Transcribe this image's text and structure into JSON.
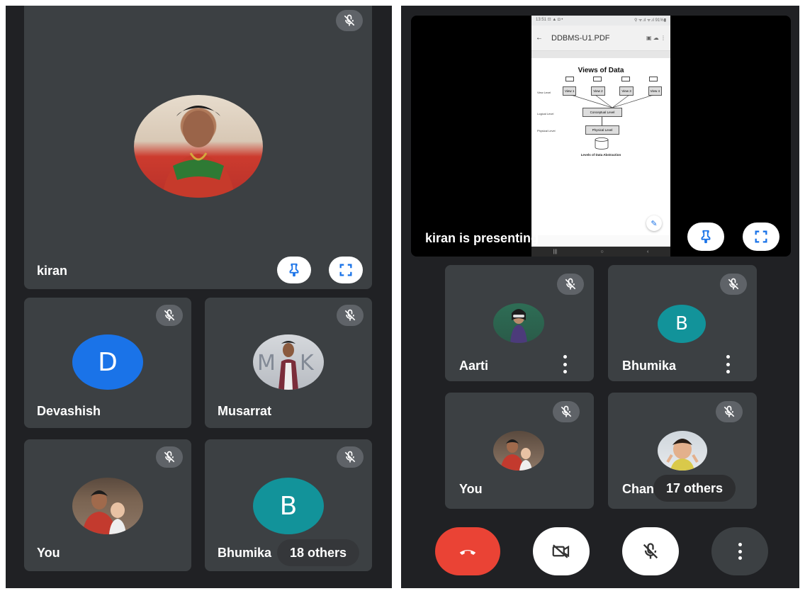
{
  "left_screen": {
    "main_tile": {
      "name": "kiran"
    },
    "tiles": [
      {
        "name": "Devashish",
        "avatar_letter": "D"
      },
      {
        "name": "Musarrat"
      },
      {
        "name": "You"
      },
      {
        "name": "Bhumika",
        "avatar_letter": "B",
        "others_label": "18 others"
      }
    ]
  },
  "right_screen": {
    "presentation": {
      "label": "kiran is presenting",
      "status_bar": "13:51 ⊡ ▲ ◘ •",
      "status_bar_right": "⚲ ᯤ.ıl ᯤ.ıl 91%▮",
      "doc_title": "DDBMS-U1.PDF",
      "slide_title": "Views of Data",
      "view_labels": [
        "View 1",
        "View 2",
        "View 3",
        "View 4"
      ],
      "view_level_label": "View Level",
      "logical_level_label": "Logical Level",
      "physical_level_label": "Physical Level",
      "conceptual_box": "Conceptual Level",
      "physical_box": "Physical Level",
      "caption": "Levels of Data Abstraction"
    },
    "tiles": [
      {
        "name": "Aarti"
      },
      {
        "name": "Bhumika",
        "avatar_letter": "B"
      },
      {
        "name": "You"
      },
      {
        "name": "Chandana",
        "others_label": "17 others"
      }
    ]
  },
  "colors": {
    "background": "#202124",
    "tile": "#3c4043",
    "end_call": "#ea4335",
    "pin_blue": "#1a73e8",
    "devashish_avatar": "#1a73e8",
    "bhumika_avatar": "#12939a"
  },
  "icons": [
    "mic-off-icon",
    "pin-icon",
    "fullscreen-icon",
    "end-call-icon",
    "camera-off-icon",
    "more-vert-icon"
  ]
}
